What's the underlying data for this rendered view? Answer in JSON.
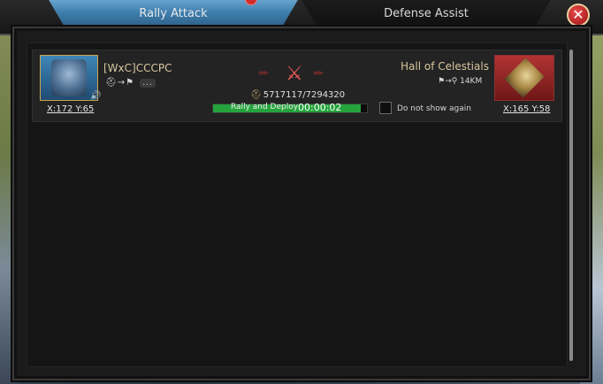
{
  "tabs": [
    {
      "label": "Rally Attack",
      "active": true,
      "has_notification": true
    },
    {
      "label": "Defense Assist",
      "active": false
    }
  ],
  "close_icon": "close-icon",
  "rally": {
    "attacker": {
      "name": "[WxC]CCCPC",
      "coords": "X:172 Y:65",
      "route_more": "..."
    },
    "troops": "5717117/7294320",
    "progress_label": "Rally and Deploy",
    "progress_fraction": 0.96,
    "timer": "00:00:02",
    "do_not_show_label": "Do not show again",
    "target": {
      "name": "Hall of Celestials",
      "distance": "14KM",
      "coords": "X:165 Y:58"
    }
  },
  "colors": {
    "tab_active": "#3f7fae",
    "progress": "#25a33c",
    "close": "#c42626",
    "name_text": "#d8c7a0"
  }
}
